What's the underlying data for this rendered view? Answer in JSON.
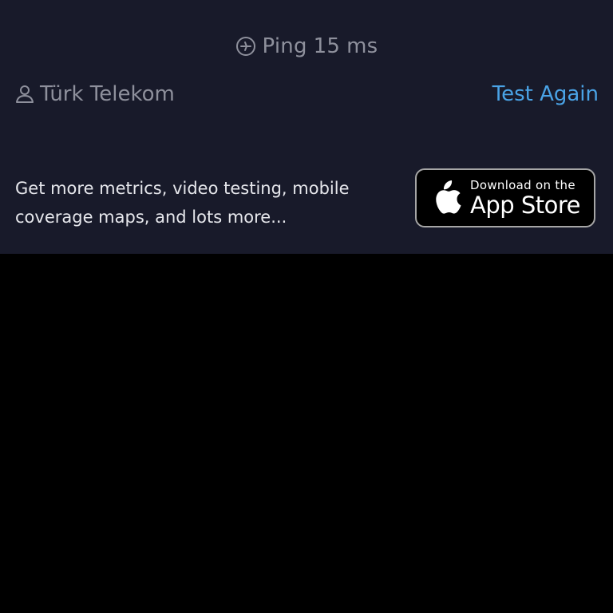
{
  "ping": {
    "icon": "ping-icon",
    "label": "Ping",
    "value": "15",
    "unit": "ms"
  },
  "isp": {
    "icon": "user-icon",
    "name": "Türk Telekom"
  },
  "actions": {
    "test_again": "Test Again"
  },
  "promo": {
    "text": "Get more metrics, video testing, mobile coverage maps, and lots more..."
  },
  "appstore_badge": {
    "icon": "apple-logo-icon",
    "small_text": "Download on the",
    "large_text": "App Store"
  },
  "colors": {
    "panel_background": "#181a2a",
    "accent": "#4aa3e6",
    "muted_text": "#8e909c",
    "page_background": "#000000"
  }
}
